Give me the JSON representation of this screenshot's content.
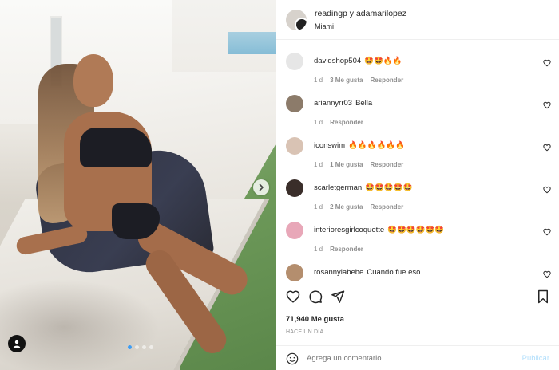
{
  "post": {
    "header": {
      "title": "readingp y adamarilopez",
      "location": "Miami"
    },
    "carousel": {
      "total": 4,
      "active": 0
    },
    "comments": [
      {
        "user": "davidshop504",
        "text": "🤩🤩🔥🔥",
        "age": "1 d",
        "likes": "3 Me gusta",
        "reply": "Responder",
        "avatar_color": "#e6e6e6"
      },
      {
        "user": "ariannyrr03",
        "text": "Bella",
        "age": "1 d",
        "likes": "",
        "reply": "Responder",
        "avatar_color": "#8c7b6a"
      },
      {
        "user": "iconswim",
        "text": "🔥🔥🔥🔥🔥🔥",
        "age": "1 d",
        "likes": "1 Me gusta",
        "reply": "Responder",
        "avatar_color": "#d9c3b4"
      },
      {
        "user": "scarletgerman",
        "text": "🤩🤩🤩🤩🤩",
        "age": "1 d",
        "likes": "2 Me gusta",
        "reply": "Responder",
        "avatar_color": "#3a2e2a"
      },
      {
        "user": "interioresgirlcoquette",
        "text": "🤩🤩🤩🤩🤩🤩",
        "age": "1 d",
        "likes": "",
        "reply": "Responder",
        "avatar_color": "#e8a7b8"
      },
      {
        "user": "rosannylabebe",
        "text": "Cuando fue eso",
        "age": "",
        "likes": "",
        "reply": "",
        "avatar_color": "#b48e6e"
      }
    ],
    "likes_count": "71,940 Me gusta",
    "time_ago": "HACE UN DÍA",
    "add_comment_placeholder": "Agrega un comentario...",
    "publish_label": "Publicar",
    "colors": {
      "accent": "#0095f6",
      "muted": "#8e8e8e",
      "publish_disabled": "#b2dffc"
    }
  }
}
